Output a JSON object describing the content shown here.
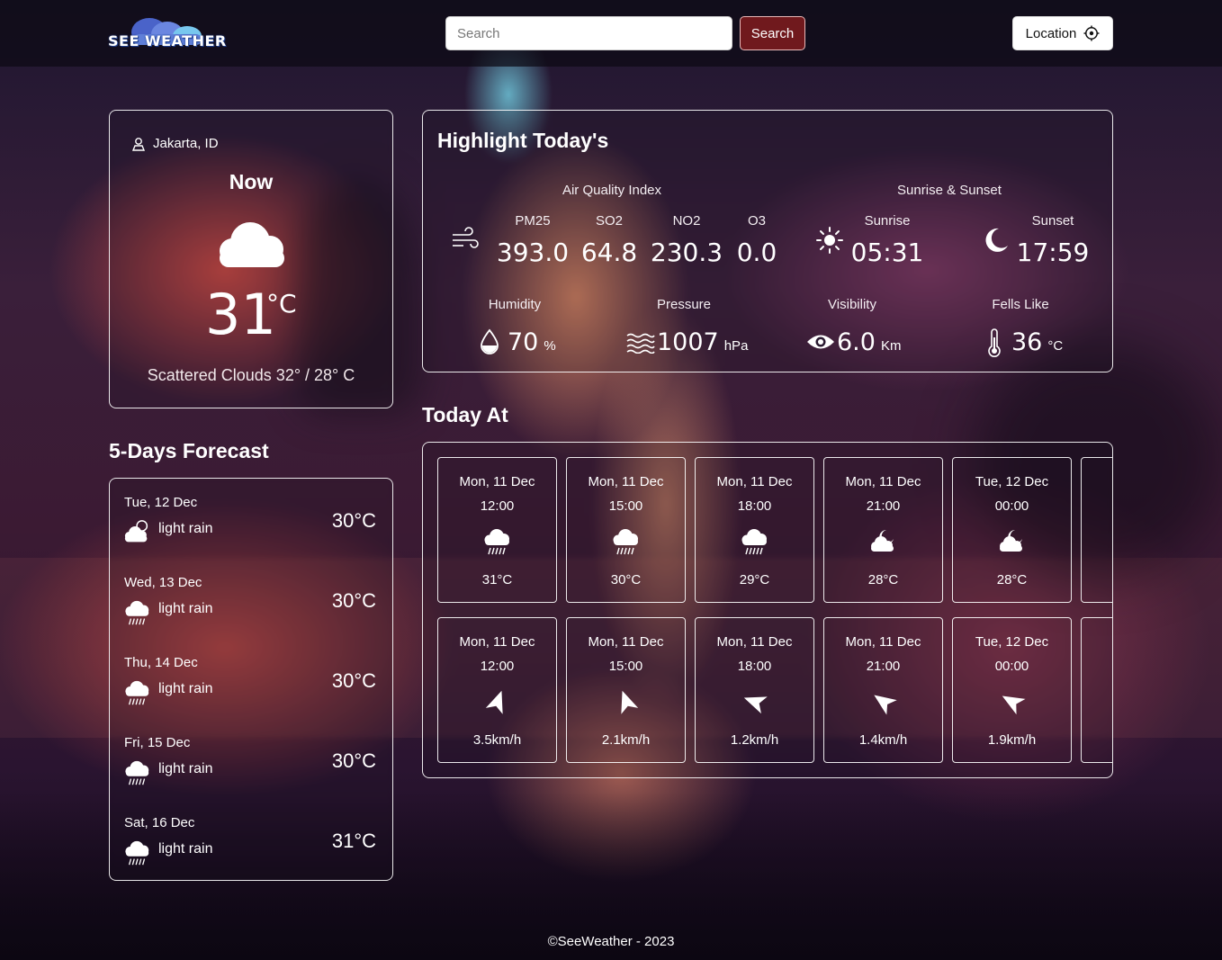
{
  "header": {
    "logo_text": "SEE WEATHER",
    "search_placeholder": "Search",
    "search_button": "Search",
    "location_button": "Location"
  },
  "now": {
    "location": "Jakarta, ID",
    "title": "Now",
    "temp": "31",
    "unit": "°C",
    "description": "Scattered Clouds 32° / 28° C",
    "icon": "cloud-icon"
  },
  "forecast": {
    "title": "5-Days Forecast",
    "days": [
      {
        "date": "Tue, 12 Dec",
        "desc": "light rain",
        "temp": "30°C",
        "icon": "partly-cloudy-rain-icon"
      },
      {
        "date": "Wed, 13 Dec",
        "desc": "light rain",
        "temp": "30°C",
        "icon": "rain-icon"
      },
      {
        "date": "Thu, 14 Dec",
        "desc": "light rain",
        "temp": "30°C",
        "icon": "rain-icon"
      },
      {
        "date": "Fri, 15 Dec",
        "desc": "light rain",
        "temp": "30°C",
        "icon": "rain-icon"
      },
      {
        "date": "Sat, 16 Dec",
        "desc": "light rain",
        "temp": "31°C",
        "icon": "rain-icon"
      }
    ]
  },
  "highlight": {
    "title": "Highlight Today's",
    "aqi": {
      "title": "Air Quality Index",
      "items": [
        {
          "label": "PM25",
          "value": "393.0"
        },
        {
          "label": "SO2",
          "value": "64.8"
        },
        {
          "label": "NO2",
          "value": "230.3"
        },
        {
          "label": "O3",
          "value": "0.0"
        }
      ]
    },
    "sun": {
      "title": "Sunrise & Sunset",
      "sunrise_label": "Sunrise",
      "sunrise": "05:31",
      "sunset_label": "Sunset",
      "sunset": "17:59"
    },
    "humidity": {
      "label": "Humidity",
      "value": "70",
      "unit": "%"
    },
    "pressure": {
      "label": "Pressure",
      "value": "1007",
      "unit": "hPa"
    },
    "visibility": {
      "label": "Visibility",
      "value": "6.0",
      "unit": "Km"
    },
    "feels_like": {
      "label": "Fells Like",
      "value": "36",
      "unit": "°C"
    }
  },
  "today": {
    "title": "Today At",
    "temps": [
      {
        "date": "Mon, 11 Dec",
        "time": "12:00",
        "value": "31°C",
        "icon": "rain-icon"
      },
      {
        "date": "Mon, 11 Dec",
        "time": "15:00",
        "value": "30°C",
        "icon": "rain-icon"
      },
      {
        "date": "Mon, 11 Dec",
        "time": "18:00",
        "value": "29°C",
        "icon": "rain-icon"
      },
      {
        "date": "Mon, 11 Dec",
        "time": "21:00",
        "value": "28°C",
        "icon": "partly-cloudy-night-icon"
      },
      {
        "date": "Tue, 12 Dec",
        "time": "00:00",
        "value": "28°C",
        "icon": "partly-cloudy-night-icon"
      }
    ],
    "winds": [
      {
        "date": "Mon, 11 Dec",
        "time": "12:00",
        "value": "3.5km/h",
        "direction_deg": 200
      },
      {
        "date": "Mon, 11 Dec",
        "time": "15:00",
        "value": "2.1km/h",
        "direction_deg": 160
      },
      {
        "date": "Mon, 11 Dec",
        "time": "18:00",
        "value": "1.2km/h",
        "direction_deg": 110
      },
      {
        "date": "Mon, 11 Dec",
        "time": "21:00",
        "value": "1.4km/h",
        "direction_deg": 125
      },
      {
        "date": "Tue, 12 Dec",
        "time": "00:00",
        "value": "1.9km/h",
        "direction_deg": 120
      }
    ]
  },
  "footer": {
    "text": "©SeeWeather - 2023"
  }
}
